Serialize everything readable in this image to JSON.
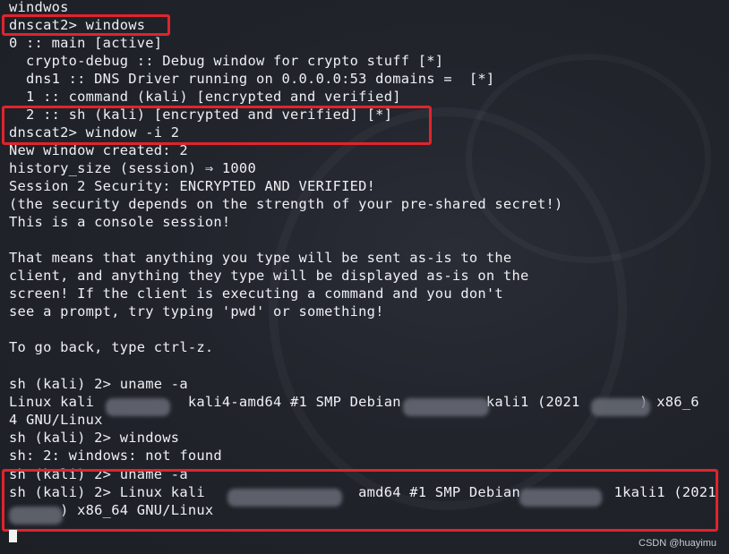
{
  "terminal": {
    "lines": [
      "windwos",
      "dnscat2> windows",
      "0 :: main [active]",
      "  crypto-debug :: Debug window for crypto stuff [*]",
      "  dns1 :: DNS Driver running on 0.0.0.0:53 domains =  [*]",
      "  1 :: command (kali) [encrypted and verified]",
      "  2 :: sh (kali) [encrypted and verified] [*]",
      "dnscat2> window -i 2",
      "New window created: 2",
      "history_size (session) ⇒ 1000",
      "Session 2 Security: ENCRYPTED AND VERIFIED!",
      "(the security depends on the strength of your pre-shared secret!)",
      "This is a console session!",
      "",
      "That means that anything you type will be sent as-is to the",
      "client, and anything they type will be displayed as-is on the",
      "screen! If the client is executing a command and you don't",
      "see a prompt, try typing 'pwd' or something!",
      "",
      "To go back, type ctrl-z.",
      "",
      "sh (kali) 2> uname -a",
      "Linux kali           kali4-amd64 #1 SMP Debian          kali1 (2021       ) x86_6",
      "4 GNU/Linux",
      "sh (kali) 2> windows",
      "sh: 2: windows: not found",
      "sh (kali) 2> uname -a",
      "sh (kali) 2> Linux kali                  amd64 #1 SMP Debian           1kali1 (2021",
      "      ) x86_64 GNU/Linux"
    ]
  },
  "watermark": "CSDN @huayimu",
  "colors": {
    "background": "#1f2129",
    "text": "#eef0f4",
    "highlight_box": "#e0242c"
  }
}
